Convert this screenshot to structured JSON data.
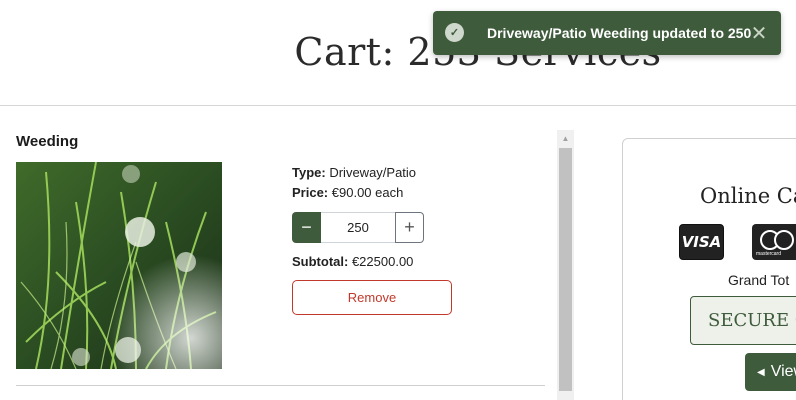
{
  "page": {
    "title": "Cart: 253 Services"
  },
  "item": {
    "name": "Weeding",
    "type_label": "Type:",
    "type_value": "Driveway/Patio",
    "price_label": "Price:",
    "price_value": "€90.00 each",
    "quantity": "250",
    "minus_symbol": "−",
    "plus_symbol": "+",
    "subtotal_label": "Subtotal:",
    "subtotal_value": "€22500.00",
    "remove_label": "Remove"
  },
  "checkout": {
    "title": "Online Ca",
    "visa_label": "VISA",
    "mastercard_label": "mastercard",
    "grand_total_label": "Grand Tot",
    "secure_label": "SECURE C",
    "view_label": "View"
  },
  "toast": {
    "message": "Driveway/Patio Weeding updated to 250",
    "close_symbol": "✕"
  },
  "colors": {
    "brand_green": "#3e5b3b",
    "danger": "#c0392b"
  },
  "icons": {
    "toast": "check-circle-icon",
    "close": "close-icon",
    "view": "caret-left-icon"
  }
}
